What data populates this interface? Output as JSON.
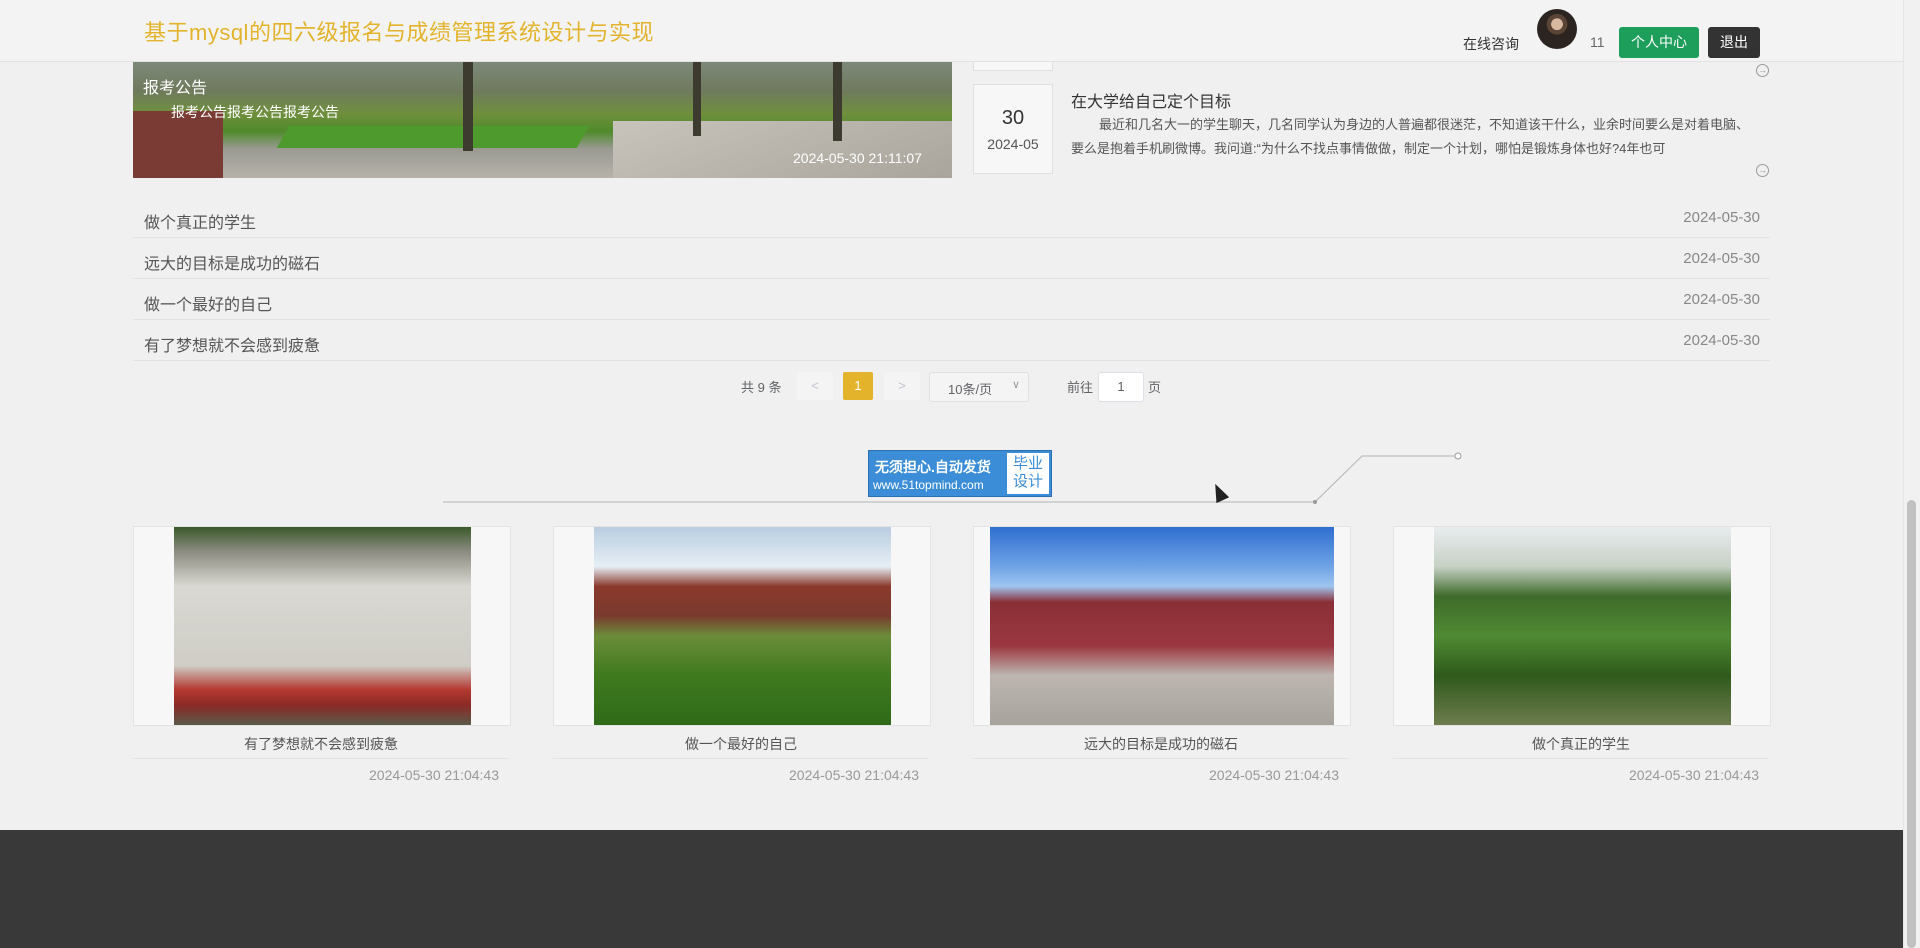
{
  "header": {
    "site_title": "基于mysql的四六级报名与成绩管理系统设计与实现",
    "consult_label": "在线咨询",
    "user_id": "11",
    "center_button": "个人中心",
    "logout_button": "退出"
  },
  "banner": {
    "title": "报考公告",
    "subtitle": "报考公告报考公告报考公告",
    "time": "2024-05-30 21:11:07"
  },
  "news": {
    "day": "30",
    "year_month": "2024-05",
    "title": "在大学给自己定个目标",
    "summary": "最近和几名大一的学生聊天，几名同学认为身边的人普遍都很迷茫，不知道该干什么，业余时间要么是对着电脑、要么是抱着手机刷微博。我问道:“为什么不找点事情做做，制定一个计划，哪怕是锻炼身体也好?4年也可",
    "more_glyph": "→"
  },
  "list": [
    {
      "title": "做个真正的学生",
      "date": "2024-05-30"
    },
    {
      "title": "远大的目标是成功的磁石",
      "date": "2024-05-30"
    },
    {
      "title": "做一个最好的自己",
      "date": "2024-05-30"
    },
    {
      "title": "有了梦想就不会感到疲惫",
      "date": "2024-05-30"
    }
  ],
  "pagination": {
    "total_text": "共 9 条",
    "prev": "<",
    "current": "1",
    "next": ">",
    "page_size": "10条/页",
    "size_chevron": "∨",
    "goto_label": "前往",
    "goto_value": "1",
    "page_label": "页"
  },
  "ad": {
    "line1": "无须担心.自动发货",
    "line2": "www.51topmind.com",
    "tag": "毕业设计"
  },
  "gallery": [
    {
      "caption": "有了梦想就不会感到疲惫",
      "time": "2024-05-30 21:04:43"
    },
    {
      "caption": "做一个最好的自己",
      "time": "2024-05-30 21:04:43"
    },
    {
      "caption": "远大的目标是成功的磁石",
      "time": "2024-05-30 21:04:43"
    },
    {
      "caption": "做个真正的学生",
      "time": "2024-05-30 21:04:43"
    }
  ],
  "colors": {
    "brand": "#e3b32c",
    "primary_button": "#1e9e5b",
    "dark_button": "#333333",
    "footer": "#393939"
  }
}
